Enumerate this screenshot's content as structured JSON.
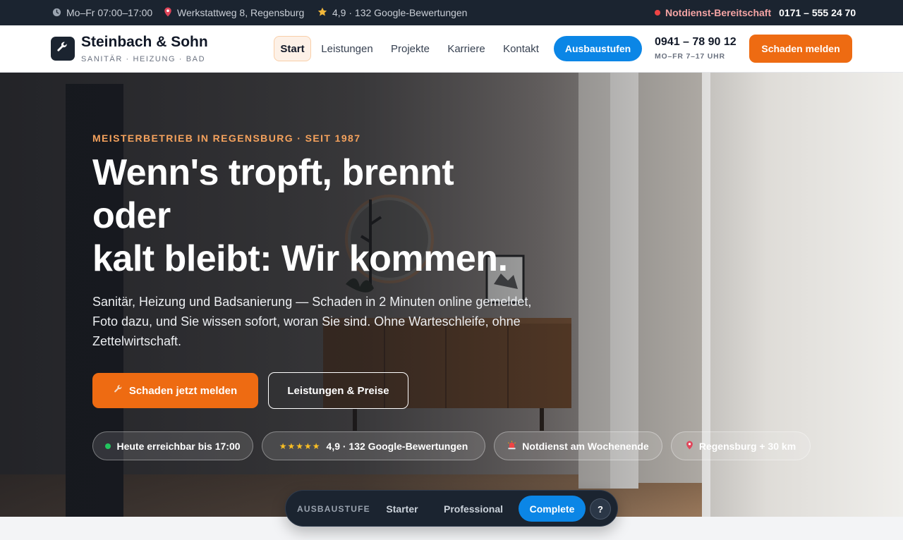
{
  "topbar": {
    "hours": "Mo–Fr 07:00–17:00",
    "address": "Werkstattweg 8, Regensburg",
    "rating": "4,9 · 132 Google-Bewertungen",
    "emergency_label": "Notdienst-Bereitschaft",
    "emergency_phone": "0171 – 555 24 70"
  },
  "header": {
    "brand_name": "Steinbach & Sohn",
    "brand_tagline": "SANITÄR · HEIZUNG · BAD",
    "nav": [
      "Start",
      "Leistungen",
      "Projekte",
      "Karriere",
      "Kontakt"
    ],
    "active_nav": "Start",
    "ausbau_button": "Ausbaustufen",
    "phone": "0941 – 78 90 12",
    "phone_hours": "MO–FR 7–17 UHR",
    "report_button": "Schaden melden"
  },
  "hero": {
    "eyebrow": "MEISTERBETRIEB IN REGENSBURG · SEIT 1987",
    "headline_lines": [
      "Wenn's tropft, brennt",
      "oder",
      "kalt bleibt: Wir kommen."
    ],
    "lead": "Sanitär, Heizung und Badsanierung — Schaden in 2 Minuten online gemeldet, Foto dazu, und Sie wissen sofort, woran Sie sind. Ohne Warteschleife, ohne Zettelwirtschaft.",
    "cta_primary": "Schaden jetzt melden",
    "cta_secondary": "Leistungen & Preise",
    "pills": {
      "availability": "Heute erreichbar bis 17:00",
      "stars": "★★★★★",
      "rating": "4,9 · 132 Google-Bewertungen",
      "emergency": "Notdienst am Wochenende",
      "area": "Regensburg + 30 km"
    }
  },
  "tierbar": {
    "label": "AUSBAUSTUFE",
    "options": [
      "Starter",
      "Professional",
      "Complete"
    ],
    "selected": "Complete",
    "help": "?"
  },
  "colors": {
    "brand_dark": "#1b2430",
    "accent_orange": "#ee6b12",
    "accent_blue": "#0b86e6",
    "eyebrow_orange": "#f5a25d",
    "status_green": "#22c55e",
    "emergency_red": "#ef4444"
  },
  "icons": {
    "topbar": [
      "clock-icon",
      "map-pin-icon",
      "star-icon",
      "status-dot-icon"
    ],
    "logo": "wrench-icon",
    "cta_primary": "wrench-icon",
    "pills": [
      "status-dot-icon",
      "stars-icon",
      "siren-icon",
      "map-pin-icon"
    ]
  }
}
